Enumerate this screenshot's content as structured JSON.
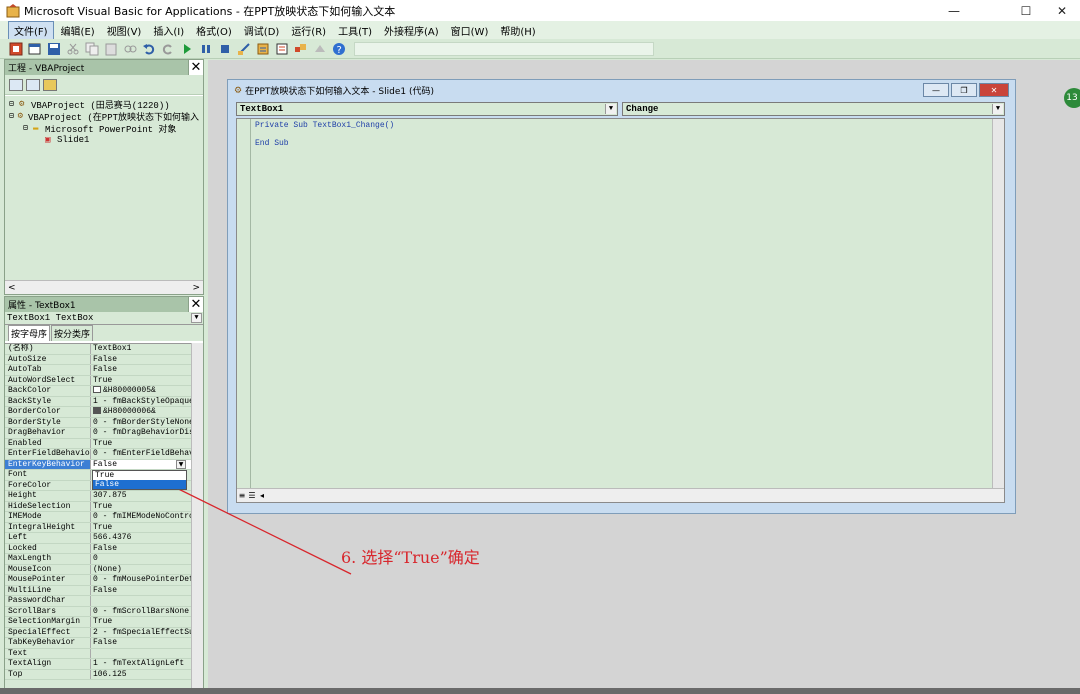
{
  "window": {
    "title": "Microsoft Visual Basic for Applications - 在PPT放映状态下如何输入文本",
    "min_icon": "minimize-icon",
    "max_icon": "maximize-icon",
    "close_icon": "close-icon",
    "min_glyph": "—",
    "max_glyph": "☐",
    "close_glyph": "✕"
  },
  "menu": [
    "文件(F)",
    "编辑(E)",
    "视图(V)",
    "插入(I)",
    "格式(O)",
    "调试(D)",
    "运行(R)",
    "工具(T)",
    "外接程序(A)",
    "窗口(W)",
    "帮助(H)"
  ],
  "project_pane": {
    "title": "工程 - VBAProject",
    "tree": [
      {
        "label": "VBAProject (田忌赛马(1220))"
      },
      {
        "label": "VBAProject (在PPT放映状态下如何输入"
      },
      {
        "label": "Microsoft PowerPoint 对象"
      },
      {
        "label": "Slide1"
      }
    ],
    "scroll_left": "<",
    "scroll_right": ">"
  },
  "properties_pane": {
    "title": "属性 - TextBox1",
    "object": "TextBox1 TextBox",
    "tabs": [
      "按字母序",
      "按分类序"
    ],
    "rows": [
      {
        "name": "(名称)",
        "value": "TextBox1"
      },
      {
        "name": "AutoSize",
        "value": "False"
      },
      {
        "name": "AutoTab",
        "value": "False"
      },
      {
        "name": "AutoWordSelect",
        "value": "True"
      },
      {
        "name": "BackColor",
        "value": "&H80000005&",
        "swatch": "#ffffff"
      },
      {
        "name": "BackStyle",
        "value": "1 - fmBackStyleOpaque"
      },
      {
        "name": "BorderColor",
        "value": "&H80000006&",
        "swatch": "#555555"
      },
      {
        "name": "BorderStyle",
        "value": "0 - fmBorderStyleNone"
      },
      {
        "name": "DragBehavior",
        "value": "0 - fmDragBehaviorDis"
      },
      {
        "name": "Enabled",
        "value": "True"
      },
      {
        "name": "EnterFieldBehavior",
        "value": "0 - fmEnterFieldBehav"
      },
      {
        "name": "EnterKeyBehavior",
        "value": "False",
        "selected": true
      },
      {
        "name": "Font",
        "value": ""
      },
      {
        "name": "ForeColor",
        "value": ""
      },
      {
        "name": "Height",
        "value": "307.875"
      },
      {
        "name": "HideSelection",
        "value": "True"
      },
      {
        "name": "IMEMode",
        "value": "0 - fmIMEModeNoContro"
      },
      {
        "name": "IntegralHeight",
        "value": "True"
      },
      {
        "name": "Left",
        "value": "566.4376"
      },
      {
        "name": "Locked",
        "value": "False"
      },
      {
        "name": "MaxLength",
        "value": "0"
      },
      {
        "name": "MouseIcon",
        "value": "(None)"
      },
      {
        "name": "MousePointer",
        "value": "0 - fmMousePointerDef"
      },
      {
        "name": "MultiLine",
        "value": "False"
      },
      {
        "name": "PasswordChar",
        "value": ""
      },
      {
        "name": "ScrollBars",
        "value": "0 - fmScrollBarsNone"
      },
      {
        "name": "SelectionMargin",
        "value": "True"
      },
      {
        "name": "SpecialEffect",
        "value": "2 - fmSpecialEffectSu"
      },
      {
        "name": "TabKeyBehavior",
        "value": "False"
      },
      {
        "name": "Text",
        "value": ""
      },
      {
        "name": "TextAlign",
        "value": "1 - fmTextAlignLeft"
      },
      {
        "name": "Top",
        "value": "106.125"
      }
    ],
    "dropdown_options": [
      "True",
      "False"
    ],
    "dropdown_highlight": 1
  },
  "code_window": {
    "title": "在PPT放映状态下如何输入文本 - Slide1 (代码)",
    "object_combo": "TextBox1",
    "proc_combo": "Change",
    "code_lines": [
      "Private Sub TextBox1_Change()",
      "",
      "End Sub"
    ]
  },
  "annotation": "6. 选择“True”确定",
  "badge": "13",
  "colors": {
    "accent": "#3c7fd4",
    "annotation": "#d8262c",
    "bg": "#d7e9d6"
  }
}
